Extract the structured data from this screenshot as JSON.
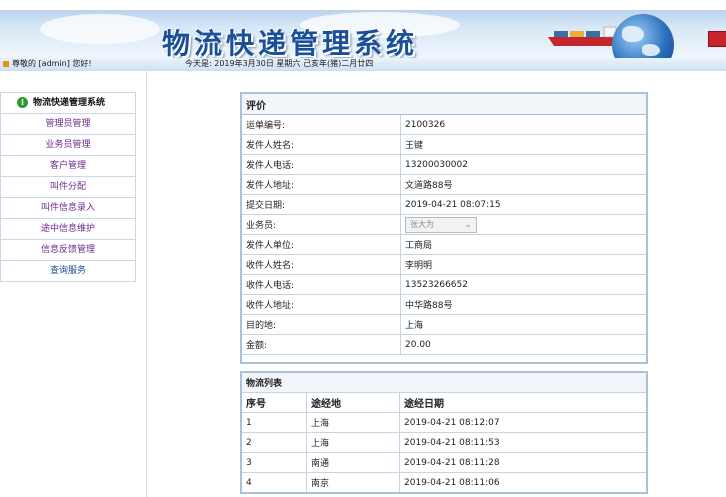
{
  "header": {
    "title": "物流快递管理系统",
    "greeting": "尊敬的 [admin] 您好!",
    "date_text": "今天是: 2019年3月30日 星期六 己亥年(猪)二月廿四"
  },
  "sidebar": {
    "heading": "物流快递管理系统",
    "items": [
      {
        "label": "管理员管理"
      },
      {
        "label": "业务员管理"
      },
      {
        "label": "客户管理"
      },
      {
        "label": "叫件分配"
      },
      {
        "label": "叫件信息录入"
      },
      {
        "label": "途中信息维护"
      },
      {
        "label": "信息反馈管理"
      },
      {
        "label": "查询服务"
      }
    ]
  },
  "evaluation": {
    "heading": "评价",
    "rows": [
      {
        "label": "运单编号:",
        "value": "2100326"
      },
      {
        "label": "发件人姓名:",
        "value": "王键"
      },
      {
        "label": "发件人电话:",
        "value": "13200030002"
      },
      {
        "label": "发件人地址:",
        "value": "文道路88号"
      },
      {
        "label": "提交日期:",
        "value": "2019-04-21 08:07:15"
      },
      {
        "label": "业务员:",
        "value": "张大为"
      },
      {
        "label": "发件人单位:",
        "value": "工商局"
      },
      {
        "label": "收件人姓名:",
        "value": "李明明"
      },
      {
        "label": "收件人电话:",
        "value": "13523266652"
      },
      {
        "label": "收件人地址:",
        "value": "中华路88号"
      },
      {
        "label": "目的地:",
        "value": "上海"
      },
      {
        "label": "金额:",
        "value": "20.00"
      }
    ]
  },
  "logistics": {
    "heading": "物流列表",
    "columns": [
      "序号",
      "途经地",
      "途经日期"
    ],
    "rows": [
      [
        "1",
        "上海",
        "2019-04-21 08:12:07"
      ],
      [
        "2",
        "上海",
        "2019-04-21 08:11:53"
      ],
      [
        "3",
        "南通",
        "2019-04-21 08:11:28"
      ],
      [
        "4",
        "南京",
        "2019-04-21 08:11:06"
      ]
    ]
  },
  "colors": {
    "title": "#1a4f9a",
    "sidebar_link": "#6a2a8c",
    "table_border": "#a9c2dc"
  }
}
